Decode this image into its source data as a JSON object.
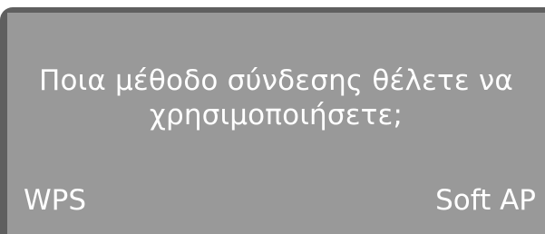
{
  "display": {
    "question": "Ποια μέθοδο σύνδεσης θέλετε να χρησιμοποιήσετε;",
    "softkeys": {
      "left": "WPS",
      "right": "Soft AP"
    }
  },
  "colors": {
    "bezel": "#5f5f5f",
    "screen": "#999999",
    "text": "#ffffff"
  }
}
